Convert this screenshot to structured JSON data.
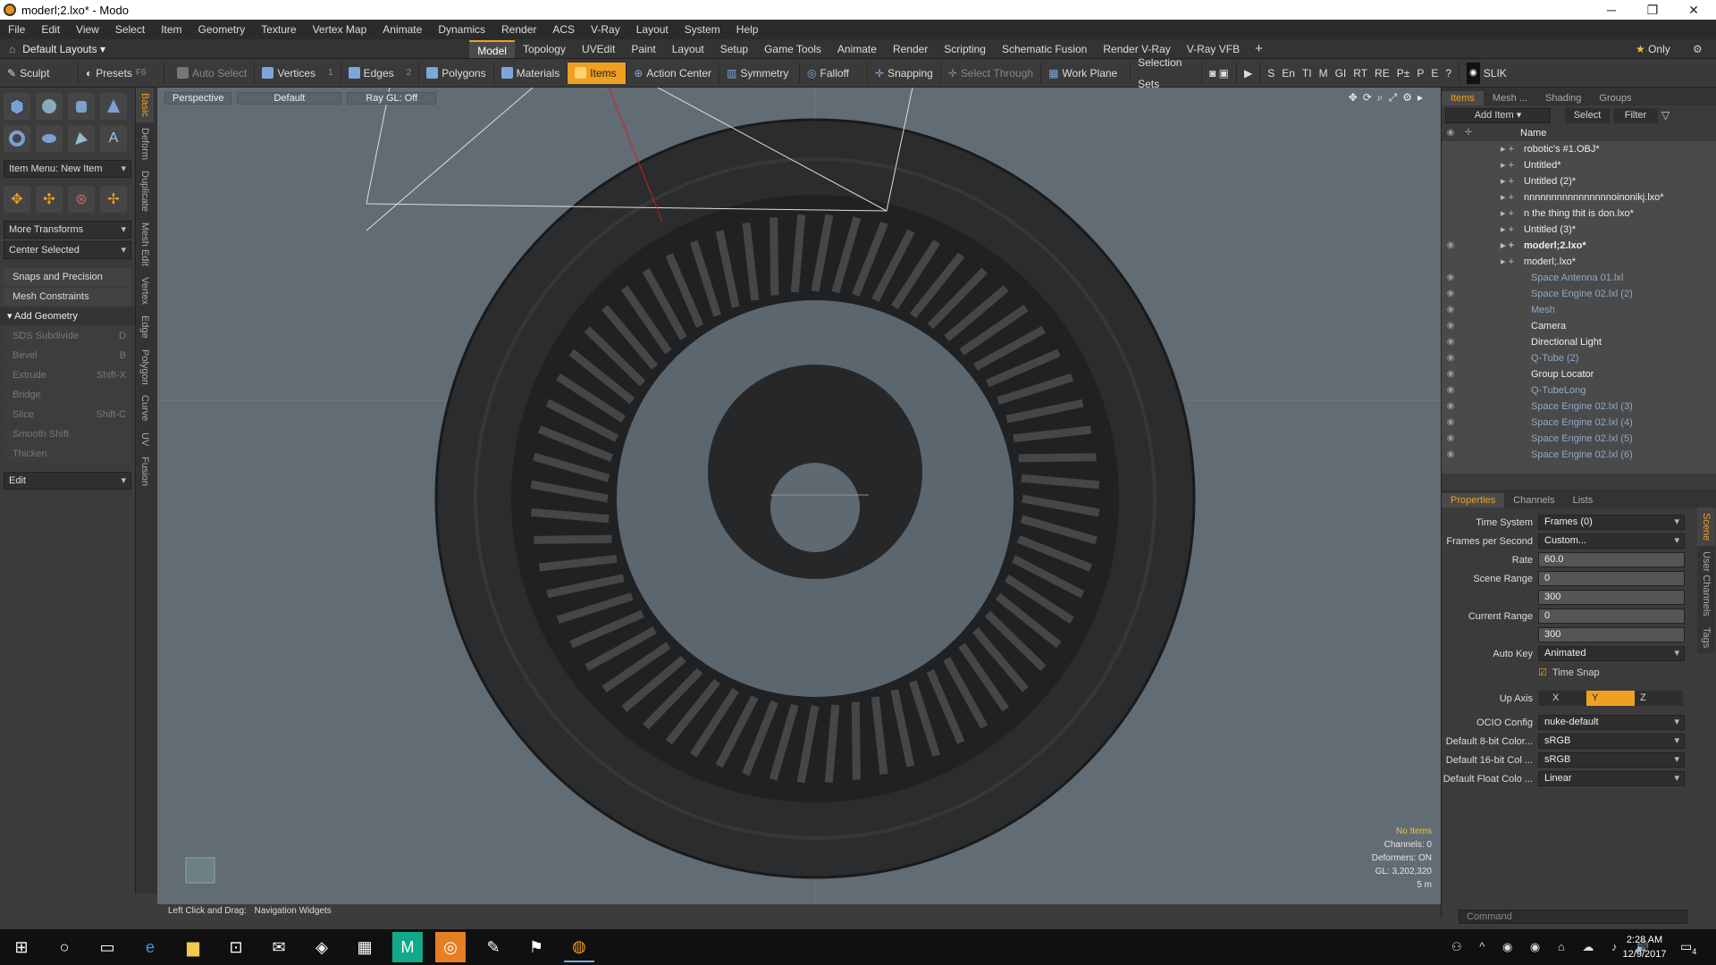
{
  "window": {
    "title": "moderl;2.lxo* - Modo",
    "minimize": "─",
    "maximize": "❐",
    "close": "✕"
  },
  "menu": [
    "File",
    "Edit",
    "View",
    "Select",
    "Item",
    "Geometry",
    "Texture",
    "Vertex Map",
    "Animate",
    "Dynamics",
    "Render",
    "ACS",
    "V-Ray",
    "Layout",
    "System",
    "Help"
  ],
  "layouts": {
    "label": "Default Layouts",
    "tabs": [
      "Model",
      "Topology",
      "UVEdit",
      "Paint",
      "Layout",
      "Setup",
      "Game Tools",
      "Animate",
      "Render",
      "Scripting",
      "Schematic Fusion",
      "Render V-Ray",
      "V-Ray VFB"
    ],
    "active": "Model",
    "only": "Only"
  },
  "toolbar": {
    "sculpt": "Sculpt",
    "presets": "Presets",
    "presets_key": "F6",
    "auto_select": "Auto Select",
    "vertices": "Vertices",
    "vertices_n": "1",
    "edges": "Edges",
    "edges_n": "2",
    "polygons": "Polygons",
    "materials": "Materials",
    "items": "Items",
    "action_center": "Action Center",
    "symmetry": "Symmetry",
    "falloff": "Falloff",
    "snapping": "Snapping",
    "select_through": "Select Through",
    "work_plane": "Work Plane",
    "selection_sets": "Selection Sets",
    "icons_right": [
      "S",
      "En",
      "TI",
      "M",
      "GI",
      "RT",
      "RE",
      "P±",
      "P",
      "E",
      "?"
    ],
    "slik": "SLIK"
  },
  "left": {
    "item_menu": "Item Menu: New Item",
    "more_transforms": "More Transforms",
    "center_selected": "Center Selected",
    "snaps": "Snaps and Precision",
    "mesh_constraints": "Mesh Constraints",
    "add_geometry": "Add Geometry",
    "tools": [
      [
        "SDS Subdivide",
        "D"
      ],
      [
        "Bevel",
        "B"
      ],
      [
        "Extrude",
        "Shift-X"
      ],
      [
        "Bridge",
        ""
      ],
      [
        "Slice",
        "Shift-C"
      ],
      [
        "Smooth Shift",
        ""
      ],
      [
        "Thicken",
        ""
      ]
    ],
    "edit": "Edit",
    "vtabs": [
      "Basic",
      "Deform",
      "Duplicate",
      "Mesh Edit",
      "Vertex",
      "Edge",
      "Polygon",
      "Curve",
      "UV",
      "Fusion"
    ]
  },
  "viewport": {
    "view": "Perspective",
    "shading": "Default",
    "raygl": "Ray GL: Off",
    "no_items": "No Items",
    "channels": "Channels: 0",
    "deformers": "Deformers: ON",
    "gl": "GL: 3,202,320",
    "scale": "5 m"
  },
  "hint": {
    "prefix": "Left Click and Drag:",
    "text": "Navigation Widgets"
  },
  "items_panel": {
    "tabs": [
      "Items",
      "Mesh ...",
      "Shading",
      "Groups"
    ],
    "add_item": "Add Item",
    "select": "Select",
    "filter": "Filter",
    "name_col": "Name",
    "rows": [
      {
        "name": "robotic's #1.OBJ*",
        "indent": 0
      },
      {
        "name": "Untitled*",
        "indent": 0
      },
      {
        "name": "Untitled (2)*",
        "indent": 0
      },
      {
        "name": "nnnnnnnnnnnnnnnnoinonikj.lxo*",
        "indent": 0
      },
      {
        "name": "n the thing thit is don.lxo*",
        "indent": 0
      },
      {
        "name": "Untitled (3)*",
        "indent": 0
      },
      {
        "name": "moderl;2.lxo*",
        "indent": 0,
        "bold": true
      },
      {
        "name": "moderl;.lxo*",
        "indent": 0
      },
      {
        "name": "Space Antenna 01.lxl",
        "indent": 1,
        "dim": true
      },
      {
        "name": "Space Engine 02.lxl (2)",
        "indent": 1,
        "dim": true
      },
      {
        "name": "Mesh",
        "indent": 1,
        "dim": true
      },
      {
        "name": "Camera",
        "indent": 1
      },
      {
        "name": "Directional Light",
        "indent": 1
      },
      {
        "name": "Q-Tube (2)",
        "indent": 1,
        "dim": true
      },
      {
        "name": "Group Locator",
        "indent": 1
      },
      {
        "name": "Q-TubeLong",
        "indent": 1,
        "dim": true
      },
      {
        "name": "Space Engine 02.lxl (3)",
        "indent": 1,
        "dim": true
      },
      {
        "name": "Space Engine 02.lxl (4)",
        "indent": 1,
        "dim": true
      },
      {
        "name": "Space Engine 02.lxl (5)",
        "indent": 1,
        "dim": true
      },
      {
        "name": "Space Engine 02.lxl (6)",
        "indent": 1,
        "dim": true
      }
    ]
  },
  "props": {
    "tabs": [
      "Properties",
      "Channels",
      "Lists"
    ],
    "side_tabs": [
      "Scene",
      "User Channels",
      "Tags"
    ],
    "time_system": {
      "label": "Time System",
      "value": "Frames (0)"
    },
    "fps": {
      "label": "Frames per Second",
      "value": "Custom..."
    },
    "rate": {
      "label": "Rate",
      "value": "60.0"
    },
    "scene_range": {
      "label": "Scene Range",
      "start": "0",
      "end": "300"
    },
    "current_range": {
      "label": "Current Range",
      "start": "0",
      "end": "300"
    },
    "auto_key": {
      "label": "Auto Key",
      "value": "Animated"
    },
    "time_snap": "Time Snap",
    "up_axis": {
      "label": "Up Axis",
      "x": "X",
      "y": "Y",
      "z": "Z"
    },
    "ocio": {
      "label": "OCIO Config",
      "value": "nuke-default"
    },
    "c8": {
      "label": "Default 8-bit Color...",
      "value": "sRGB"
    },
    "c16": {
      "label": "Default 16-bit Col ...",
      "value": "sRGB"
    },
    "cf": {
      "label": "Default Float Colo ...",
      "value": "Linear"
    }
  },
  "command": {
    "placeholder": "Command"
  },
  "clock": {
    "time": "2:28 AM",
    "date": "12/9/2017",
    "notif": "4"
  },
  "accent": "#f0a020"
}
